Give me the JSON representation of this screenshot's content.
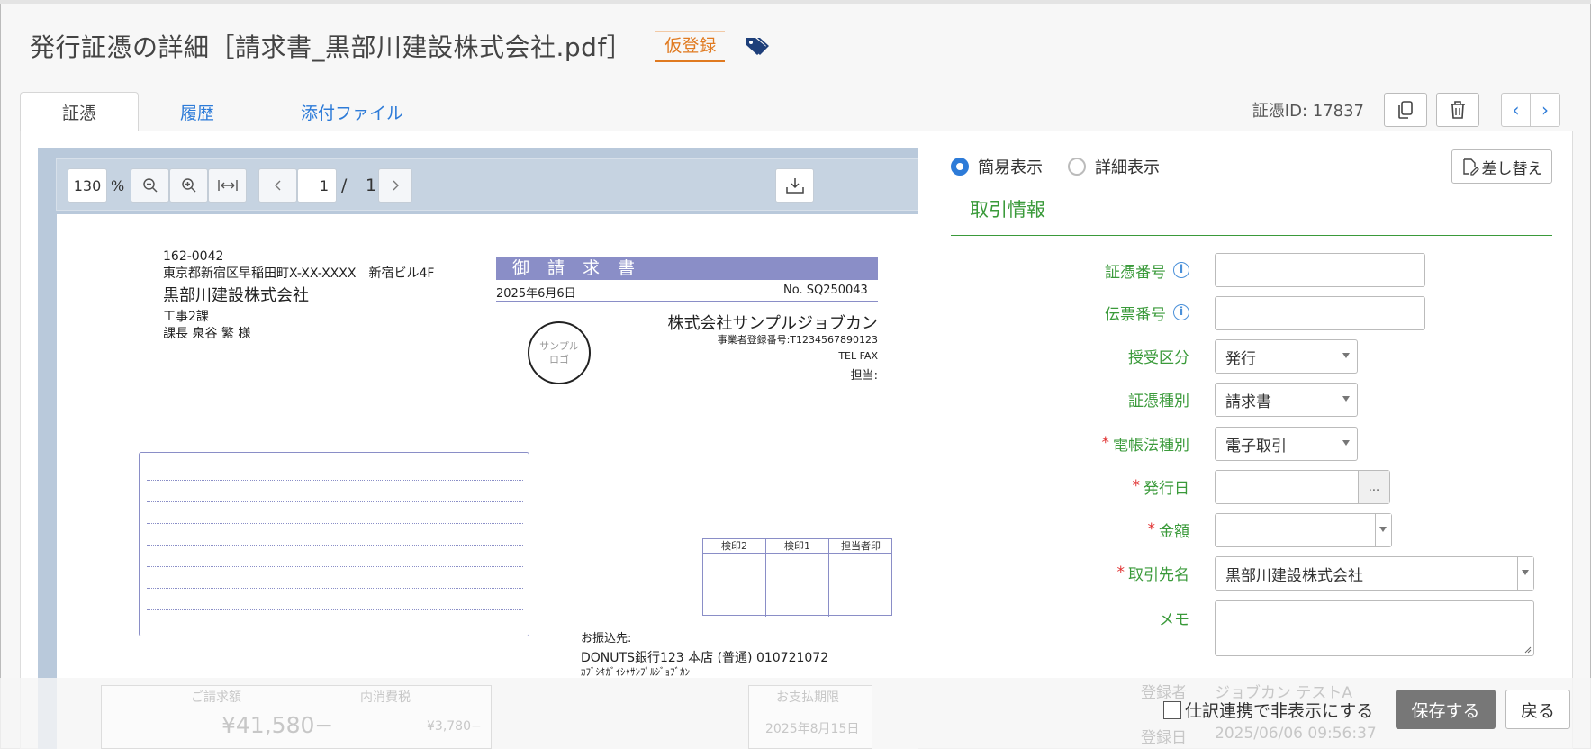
{
  "header": {
    "title": "発行証憑の詳細［請求書_黒部川建設株式会社.pdf］",
    "badge": "仮登録",
    "tag_icon": "tags-icon"
  },
  "tabs": [
    {
      "label": "証憑",
      "active": true
    },
    {
      "label": "履歴",
      "active": false
    },
    {
      "label": "添付ファイル",
      "active": false
    }
  ],
  "idbar": {
    "id_text": "証憑ID: 17837",
    "copy_icon": "copy-icon",
    "delete_icon": "trash-icon",
    "prev": "‹",
    "next": "›"
  },
  "viewer": {
    "zoom": "130",
    "zoom_unit": "%",
    "page_current": "1",
    "page_sep": "/",
    "page_total": "1"
  },
  "invoice": {
    "postal": "162-0042",
    "address": "東京都新宿区早稲田町X-XX-XXXX　新宿ビル4F",
    "to_company": "黒部川建設株式会社",
    "to_dept": "工事2課",
    "to_person": "課長 泉谷 繁 様",
    "doc_title": "御請求書",
    "date": "2025年6月6日",
    "number": "No. SQ250043",
    "from_company": "株式会社サンプルジョブカン",
    "registration": "事業者登録番号:T1234567890123",
    "tel_fax": "TEL FAX",
    "contact": "担当:",
    "logo_line1": "サンプル",
    "logo_line2": "ロゴ",
    "seals": [
      "検印2",
      "検印1",
      "担当者印"
    ],
    "bank_label": "お振込先:",
    "bank_info": "DONUTS銀行123 本店 (普通) 010721072",
    "bank_kana": "ｶﾌﾞｼｷｶﾞｲｼｬｻﾝﾌﾟﾙｼﾞｮﾌﾞｶﾝ",
    "total_label": "ご請求額",
    "total_value": "¥41,580−",
    "tax_label": "内消費税",
    "tax_value": "¥3,780−",
    "due_label": "お支払期限",
    "due_value": "2025年8月15日"
  },
  "form": {
    "radio_simple": "簡易表示",
    "radio_detail": "詳細表示",
    "replace_button": "差し替え",
    "section_title": "取引情報",
    "fields": {
      "voucher_no": {
        "label": "証憑番号",
        "value": ""
      },
      "slip_no": {
        "label": "伝票番号",
        "value": ""
      },
      "direction": {
        "label": "授受区分",
        "value": "発行"
      },
      "voucher_type": {
        "label": "証憑種別",
        "value": "請求書"
      },
      "law_type": {
        "label": "電帳法種別",
        "value": "電子取引",
        "required": true
      },
      "issue_date": {
        "label": "発行日",
        "value": "",
        "required": true,
        "button": "..."
      },
      "amount": {
        "label": "金額",
        "value": "",
        "required": true
      },
      "partner": {
        "label": "取引先名",
        "value": "黒部川建設株式会社",
        "required": true
      },
      "memo": {
        "label": "メモ",
        "value": ""
      }
    },
    "required_mark": "*",
    "registrant_label": "登録者",
    "registrant_value": "ジョブカン テストA",
    "regdate_label": "登録日",
    "regdate_value": "2025/06/06 09:56:37"
  },
  "footer": {
    "hide_checkbox_label": "仕訳連携で非表示にする",
    "save_button": "保存する",
    "back_button": "戻る"
  },
  "colors": {
    "accent_blue": "#2d7bd8",
    "badge_orange": "#e07a20",
    "label_green": "#3a9a3a",
    "required_red": "#e03030",
    "invoice_purple": "#8a8ec7",
    "viewer_bg": "#b9c9db"
  }
}
